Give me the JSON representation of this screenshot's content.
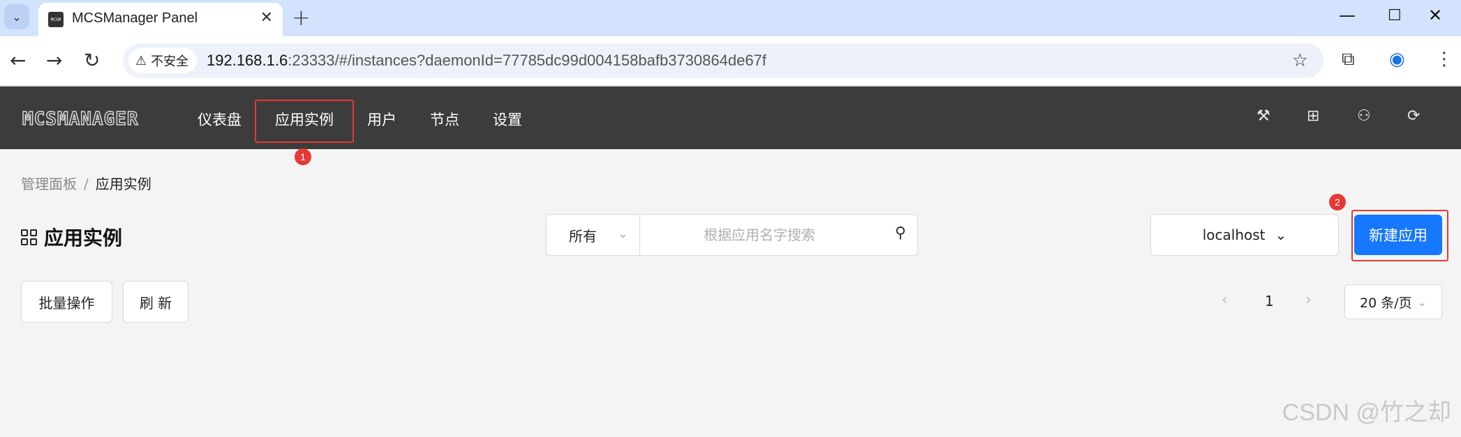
{
  "browser": {
    "tab_title": "MCSManager Panel",
    "favicon_text": "MCSM",
    "insecure_label": "不安全",
    "url_host": "192.168.1.6",
    "url_rest": ":23333/#/instances?daemonId=77785dc99d004158bafb3730864de67f"
  },
  "app": {
    "logo": "MCSMANAGER",
    "menu": [
      "仪表盘",
      "应用实例",
      "用户",
      "节点",
      "设置"
    ],
    "active_menu": "应用实例"
  },
  "annotations": {
    "marker1": "1",
    "marker2": "2"
  },
  "breadcrumb": {
    "root": "管理面板",
    "sep": "/",
    "current": "应用实例"
  },
  "page": {
    "title": "应用实例"
  },
  "filter": {
    "status_value": "所有",
    "search_placeholder": "根据应用名字搜索"
  },
  "node": {
    "selected": "localhost"
  },
  "actions": {
    "new_app": "新建应用",
    "batch": "批量操作",
    "refresh": "刷 新"
  },
  "pagination": {
    "current": "1",
    "page_size": "20 条/页"
  },
  "watermark": "CSDN @竹之却",
  "colors": {
    "primary": "#1677ff",
    "header_bg": "#3c3c3c",
    "annotation": "#e53935"
  }
}
